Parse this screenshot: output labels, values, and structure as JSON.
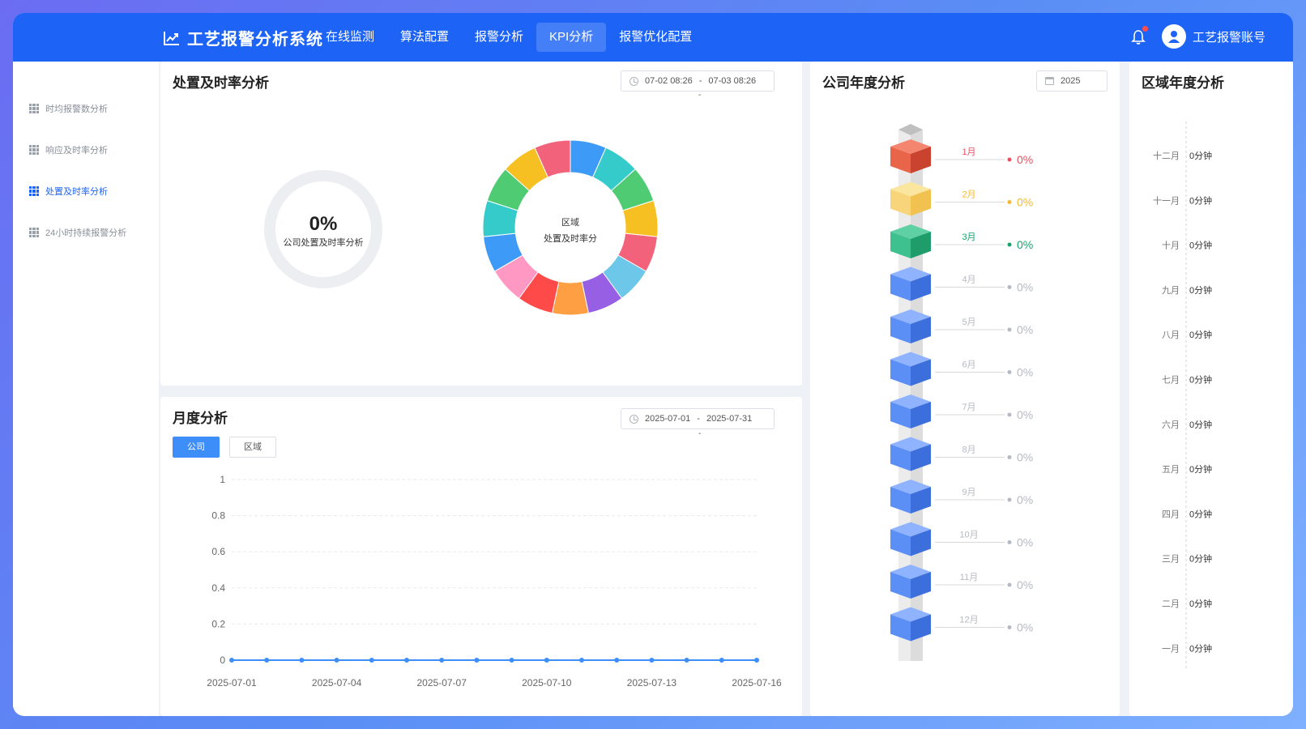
{
  "header": {
    "brand": "工艺报警分析系统",
    "nav": [
      "在线监测",
      "算法配置",
      "报警分析",
      "KPI分析",
      "报警优化配置"
    ],
    "active_nav": 3,
    "user": "工艺报警账号"
  },
  "sidebar": {
    "items": [
      "时均报警数分析",
      "响应及时率分析",
      "处置及时率分析",
      "24小时持续报警分析"
    ],
    "active": 2
  },
  "disposal": {
    "title": "处置及时率分析",
    "start": "07-02 08:26",
    "end": "07-03 08:26",
    "range_sep": "-",
    "gauge_value": "0%",
    "gauge_label": "公司处置及时率分析",
    "ring_label_1": "区域",
    "ring_label_2": "处置及时率分",
    "ring_colors": [
      "#3d9bf7",
      "#36cbcb",
      "#4ecb73",
      "#f6c022",
      "#f2637b",
      "#6cc7e9",
      "#975fe4",
      "#ff9f43",
      "#ff4a4a",
      "#ff99c3",
      "#3d9bf7",
      "#36cbcb",
      "#4ecb73",
      "#f6c022",
      "#f2637b"
    ]
  },
  "monthly": {
    "title": "月度分析",
    "start": "2025-07-01",
    "end": "2025-07-31",
    "range_sep": "-",
    "tabs": [
      "公司",
      "区域"
    ],
    "active_tab": 0,
    "chart_data": {
      "type": "line",
      "x": [
        "2025-07-01",
        "2025-07-02",
        "2025-07-03",
        "2025-07-04",
        "2025-07-05",
        "2025-07-06",
        "2025-07-07",
        "2025-07-08",
        "2025-07-09",
        "2025-07-10",
        "2025-07-11",
        "2025-07-12",
        "2025-07-13",
        "2025-07-14",
        "2025-07-15",
        "2025-07-16"
      ],
      "x_tick_labels": [
        "2025-07-01",
        "2025-07-04",
        "2025-07-07",
        "2025-07-10",
        "2025-07-13",
        "2025-07-16"
      ],
      "series": [
        {
          "values": [
            0,
            0,
            0,
            0,
            0,
            0,
            0,
            0,
            0,
            0,
            0,
            0,
            0,
            0,
            0,
            0
          ]
        }
      ],
      "y_ticks": [
        "1",
        "0.8",
        "0.6",
        "0.4",
        "0.2",
        "0"
      ],
      "ylim": [
        0,
        1
      ],
      "grid": true,
      "color": "#3d8ef8"
    }
  },
  "company_year": {
    "title": "公司年度分析",
    "year": "2025",
    "months": [
      {
        "label": "1月",
        "value": "0%",
        "color": "#ea4f5f",
        "top": "#f4856f",
        "left": "#e8654a",
        "right": "#c9432f"
      },
      {
        "label": "2月",
        "value": "0%",
        "color": "#f7b731",
        "top": "#fbe6a0",
        "left": "#f8d57a",
        "right": "#f1c24f"
      },
      {
        "label": "3月",
        "value": "0%",
        "color": "#13a36d",
        "top": "#5fd0a3",
        "left": "#3ec08f",
        "right": "#1e9c6a"
      },
      {
        "label": "4月",
        "value": "0%",
        "color": "#b5b9c2",
        "top": "#8fb3ff",
        "left": "#5b8ff5",
        "right": "#3d6fdc"
      },
      {
        "label": "5月",
        "value": "0%",
        "color": "#b5b9c2",
        "top": "#8fb3ff",
        "left": "#5b8ff5",
        "right": "#3d6fdc"
      },
      {
        "label": "6月",
        "value": "0%",
        "color": "#b5b9c2",
        "top": "#8fb3ff",
        "left": "#5b8ff5",
        "right": "#3d6fdc"
      },
      {
        "label": "7月",
        "value": "0%",
        "color": "#b5b9c2",
        "top": "#8fb3ff",
        "left": "#5b8ff5",
        "right": "#3d6fdc"
      },
      {
        "label": "8月",
        "value": "0%",
        "color": "#b5b9c2",
        "top": "#8fb3ff",
        "left": "#5b8ff5",
        "right": "#3d6fdc"
      },
      {
        "label": "9月",
        "value": "0%",
        "color": "#b5b9c2",
        "top": "#8fb3ff",
        "left": "#5b8ff5",
        "right": "#3d6fdc"
      },
      {
        "label": "10月",
        "value": "0%",
        "color": "#b5b9c2",
        "top": "#8fb3ff",
        "left": "#5b8ff5",
        "right": "#3d6fdc"
      },
      {
        "label": "11月",
        "value": "0%",
        "color": "#b5b9c2",
        "top": "#8fb3ff",
        "left": "#5b8ff5",
        "right": "#3d6fdc"
      },
      {
        "label": "12月",
        "value": "0%",
        "color": "#b5b9c2",
        "top": "#8fb3ff",
        "left": "#5b8ff5",
        "right": "#3d6fdc"
      }
    ]
  },
  "region_year": {
    "title": "区域年度分析",
    "rows": [
      {
        "month": "十二月",
        "value": "0分钟"
      },
      {
        "month": "十一月",
        "value": "0分钟"
      },
      {
        "month": "十月",
        "value": "0分钟"
      },
      {
        "month": "九月",
        "value": "0分钟"
      },
      {
        "month": "八月",
        "value": "0分钟"
      },
      {
        "month": "七月",
        "value": "0分钟"
      },
      {
        "month": "六月",
        "value": "0分钟"
      },
      {
        "month": "五月",
        "value": "0分钟"
      },
      {
        "month": "四月",
        "value": "0分钟"
      },
      {
        "month": "三月",
        "value": "0分钟"
      },
      {
        "month": "二月",
        "value": "0分钟"
      },
      {
        "month": "一月",
        "value": "0分钟"
      }
    ]
  }
}
